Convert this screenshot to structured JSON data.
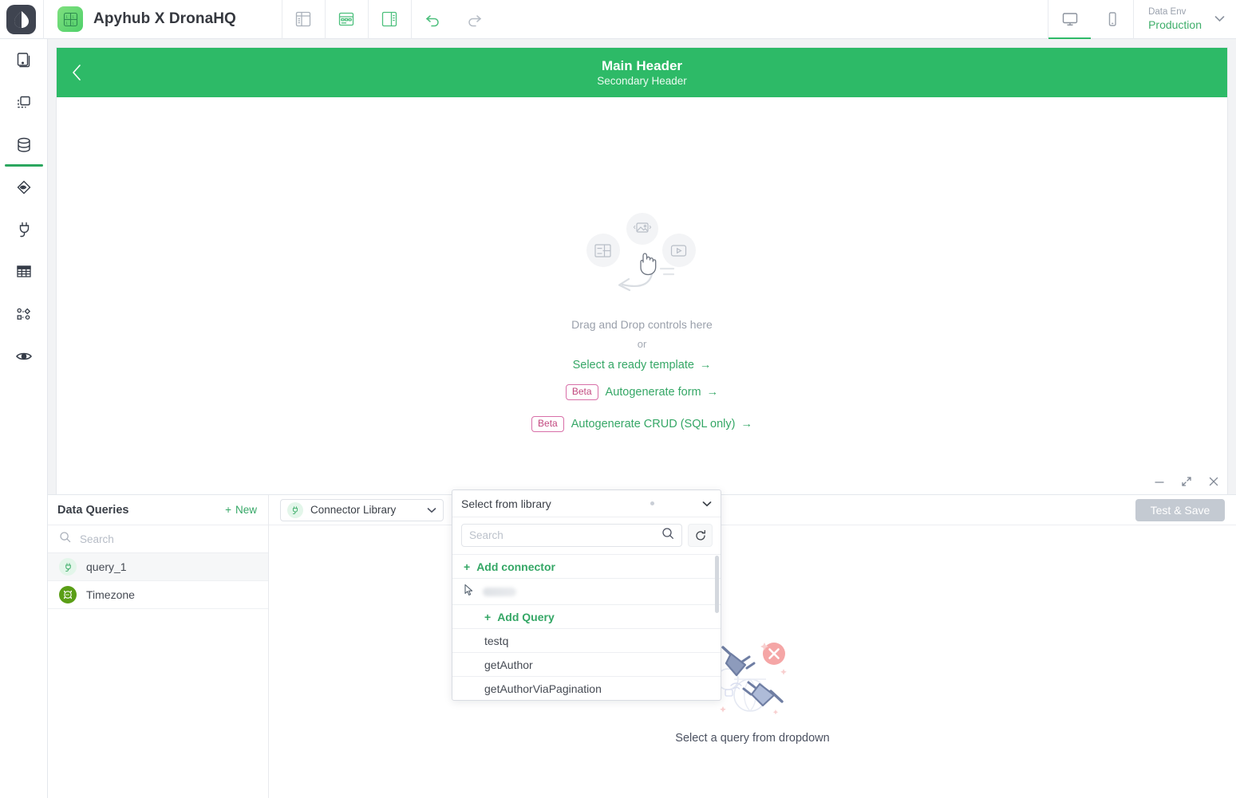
{
  "topbar": {
    "logo_icon": "dronahq-logo-icon",
    "app_badge_icon": "app-grid-icon",
    "app_title": "Apyhub X DronaHQ",
    "tools": [
      {
        "name": "layout-sidebar-icon",
        "active": false
      },
      {
        "name": "layout-table-icon",
        "active": false
      },
      {
        "name": "layout-split-icon",
        "active": false
      }
    ],
    "history": [
      {
        "name": "undo-icon"
      },
      {
        "name": "redo-icon"
      }
    ],
    "devices": [
      {
        "name": "desktop-view-icon",
        "active": true
      },
      {
        "name": "mobile-view-icon",
        "active": false
      }
    ],
    "env": {
      "label": "Data Env",
      "value": "Production",
      "caret_icon": "chevron-down-icon"
    }
  },
  "rail": {
    "items": [
      {
        "name": "sidebar-item-screens",
        "icon": "screens-icon",
        "active": false
      },
      {
        "name": "sidebar-item-layouts",
        "icon": "layouts-icon",
        "active": false
      },
      {
        "name": "sidebar-item-data",
        "icon": "database-icon",
        "active": true
      },
      {
        "name": "sidebar-item-preview-eye",
        "icon": "eye-diamond-icon",
        "active": false
      },
      {
        "name": "sidebar-item-connectors",
        "icon": "plug-icon",
        "active": false
      },
      {
        "name": "sidebar-item-tables",
        "icon": "table-icon",
        "active": false
      },
      {
        "name": "sidebar-item-workflows",
        "icon": "workflow-icon",
        "active": false
      },
      {
        "name": "sidebar-item-preview",
        "icon": "eye-icon",
        "active": false
      }
    ]
  },
  "canvas": {
    "header": {
      "back_icon": "chevron-left-icon",
      "main": "Main Header",
      "secondary": "Secondary Header",
      "color": "#2dba67"
    },
    "dropzone": {
      "line1": "Drag and Drop controls here",
      "or": "or",
      "template_link": "Select a ready template",
      "arrow": "→",
      "beta_badge": "Beta",
      "form_link": "Autogenerate form",
      "crud_link": "Autogenerate CRUD (SQL only)"
    }
  },
  "bottom_panel": {
    "window_controls": [
      {
        "name": "minimize-button",
        "glyph": "—"
      },
      {
        "name": "expand-button",
        "glyph": "⤢"
      },
      {
        "name": "close-button",
        "glyph": "✕"
      }
    ],
    "data_queries": {
      "title": "Data Queries",
      "new_label": "New",
      "new_plus": "+",
      "search_placeholder": "Search",
      "search_value": "",
      "items": [
        {
          "label": "query_1",
          "icon": "plug-icon",
          "selected": true
        },
        {
          "label": "Timezone",
          "icon": "timezone-icon",
          "selected": false
        }
      ]
    },
    "toolbar": {
      "connector_select": "Connector Library",
      "connector_icon": "plug-icon",
      "caret_icon": "chevron-down-icon",
      "test_save_label": "Test & Save"
    },
    "empty_state": {
      "illustration": "disconnected-plugs-icon",
      "caption": "Select a query from dropdown"
    },
    "library_dropdown": {
      "selected_label": "Select from library",
      "caret_icon": "chevron-down-icon",
      "search_placeholder": "Search",
      "search_value": "",
      "search_icon": "search-icon",
      "refresh_icon": "refresh-icon",
      "add_connector_label": "Add connector",
      "add_connector_plus": "+",
      "add_query_label": "Add Query",
      "add_query_plus": "+",
      "cursor_icon": "mouse-pointer-icon",
      "queries": [
        {
          "label": "testq"
        },
        {
          "label": "getAuthor"
        },
        {
          "label": "getAuthorViaPagination"
        }
      ]
    }
  }
}
